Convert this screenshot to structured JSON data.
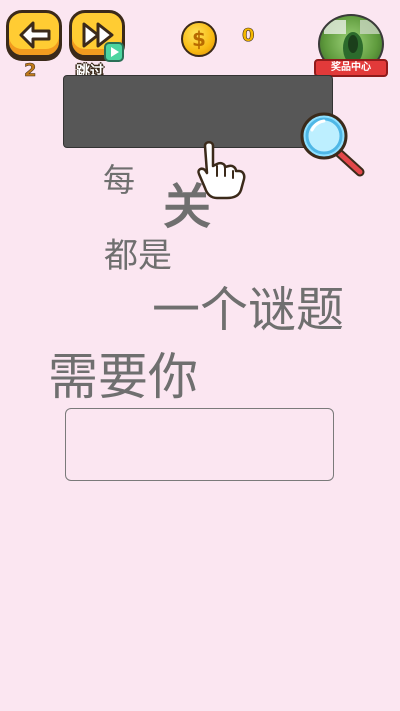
{
  "top_bar": {
    "back_icon": "arrow-left-icon",
    "skip_icon": "fast-forward-icon",
    "level": "2",
    "skip_label": "跳过",
    "coin_icon": "coin-icon",
    "coin_symbol": "$",
    "coin_count": "0",
    "reward_label": "奖品中心"
  },
  "puzzle": {
    "words": [
      "每",
      "关",
      "都是",
      "一个谜题",
      "需要你"
    ],
    "hint_icons": [
      "magnifier-icon",
      "pointing-hand-icon"
    ]
  },
  "answer": {
    "value": ""
  },
  "colors": {
    "background": "#fbe6f1",
    "button_yellow": "#ffcc33",
    "dark_box": "#575757",
    "word_gray": "#6f6f6f",
    "banner_red": "#e23a3a"
  }
}
